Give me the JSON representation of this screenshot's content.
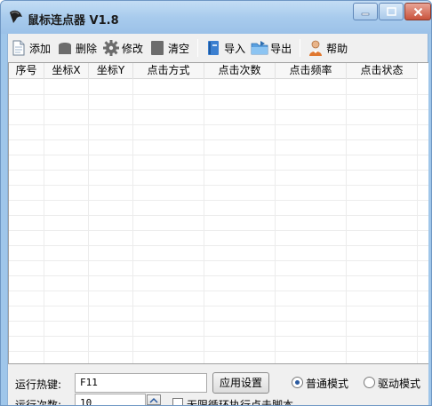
{
  "window": {
    "title": "鼠标连点器 V1.8",
    "accent": "#9fc6ea",
    "close_color": "#c9533c"
  },
  "toolbar": {
    "items": [
      {
        "label": "添加",
        "icon": "add-document-icon"
      },
      {
        "label": "删除",
        "icon": "delete-icon"
      },
      {
        "label": "修改",
        "icon": "gear-icon"
      },
      {
        "label": "清空",
        "icon": "clear-icon"
      },
      {
        "label": "导入",
        "icon": "import-book-icon"
      },
      {
        "label": "导出",
        "icon": "export-folder-icon"
      },
      {
        "label": "帮助",
        "icon": "person-help-icon"
      }
    ]
  },
  "table": {
    "columns": [
      "序号",
      "坐标X",
      "坐标Y",
      "点击方式",
      "点击次数",
      "点击频率",
      "点击状态"
    ],
    "rows": []
  },
  "settings": {
    "hotkey_label": "运行热键:",
    "hotkey_value": "F11",
    "apply_button": "应用设置",
    "mode_normal": "普通模式",
    "mode_driver": "驱动模式",
    "mode_selected": "普通模式",
    "count_label": "运行次数:",
    "count_value": "10",
    "loop_label": "无限循环执行点击脚本",
    "loop_checked": false
  }
}
